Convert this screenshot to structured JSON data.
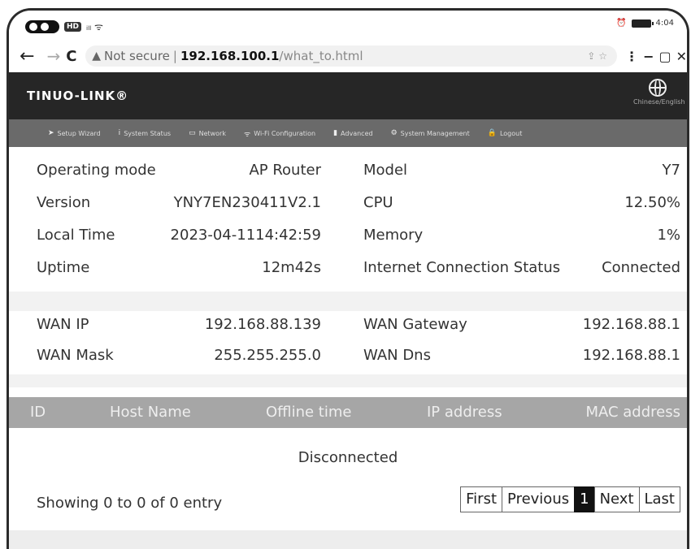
{
  "status_bar": {
    "hd": "HD",
    "signal": "ᵢₗₗ ᯤ",
    "time": "4:04"
  },
  "browser": {
    "security": "Not secure",
    "separator": "|",
    "url_host": "192.168.100.1",
    "url_path": "/what_to.html"
  },
  "router": {
    "logo": "TINUO-LINK®",
    "language": "Chinese/English",
    "menu": [
      {
        "icon": "send-icon",
        "label": "Setup Wizard"
      },
      {
        "icon": "info-icon",
        "label": "System Status"
      },
      {
        "icon": "monitor-icon",
        "label": "Network"
      },
      {
        "icon": "wifi-icon",
        "label": "Wi-Fi Configuration"
      },
      {
        "icon": "book-icon",
        "label": "Advanced"
      },
      {
        "icon": "gears-icon",
        "label": "System Management"
      },
      {
        "icon": "lock-icon",
        "label": "Logout"
      }
    ]
  },
  "system_info": [
    {
      "label": "Operating mode",
      "value": "AP Router",
      "label2": "Model",
      "value2": "Y7"
    },
    {
      "label": "Version",
      "value": "YNY7EN230411V2.1",
      "label2": "CPU",
      "value2": "12.50%"
    },
    {
      "label": "Local Time",
      "value": "2023-04-1114:42:59",
      "label2": "Memory",
      "value2": "1%"
    },
    {
      "label": "Uptime",
      "value": "12m42s",
      "label2": "Internet Connection Status",
      "value2": "Connected"
    }
  ],
  "wan_info": [
    {
      "label": "WAN IP",
      "value": "192.168.88.139",
      "label2": "WAN Gateway",
      "value2": "192.168.88.1"
    },
    {
      "label": "WAN Mask",
      "value": "255.255.255.0",
      "label2": "WAN Dns",
      "value2": "192.168.88.1"
    }
  ],
  "table": {
    "columns": [
      "ID",
      "Host Name",
      "Offline time",
      "IP address",
      "MAC address"
    ],
    "empty_message": "Disconnected",
    "showing": "Showing 0 to 0   of 0 entry",
    "pager": {
      "first": "First",
      "previous": "Previous",
      "current": "1",
      "next": "Next",
      "last": "Last"
    }
  },
  "colors": {
    "header": "#262626",
    "menu": "#6a6a6a",
    "table_header": "#a6a6a6",
    "page_active": "#111111"
  }
}
